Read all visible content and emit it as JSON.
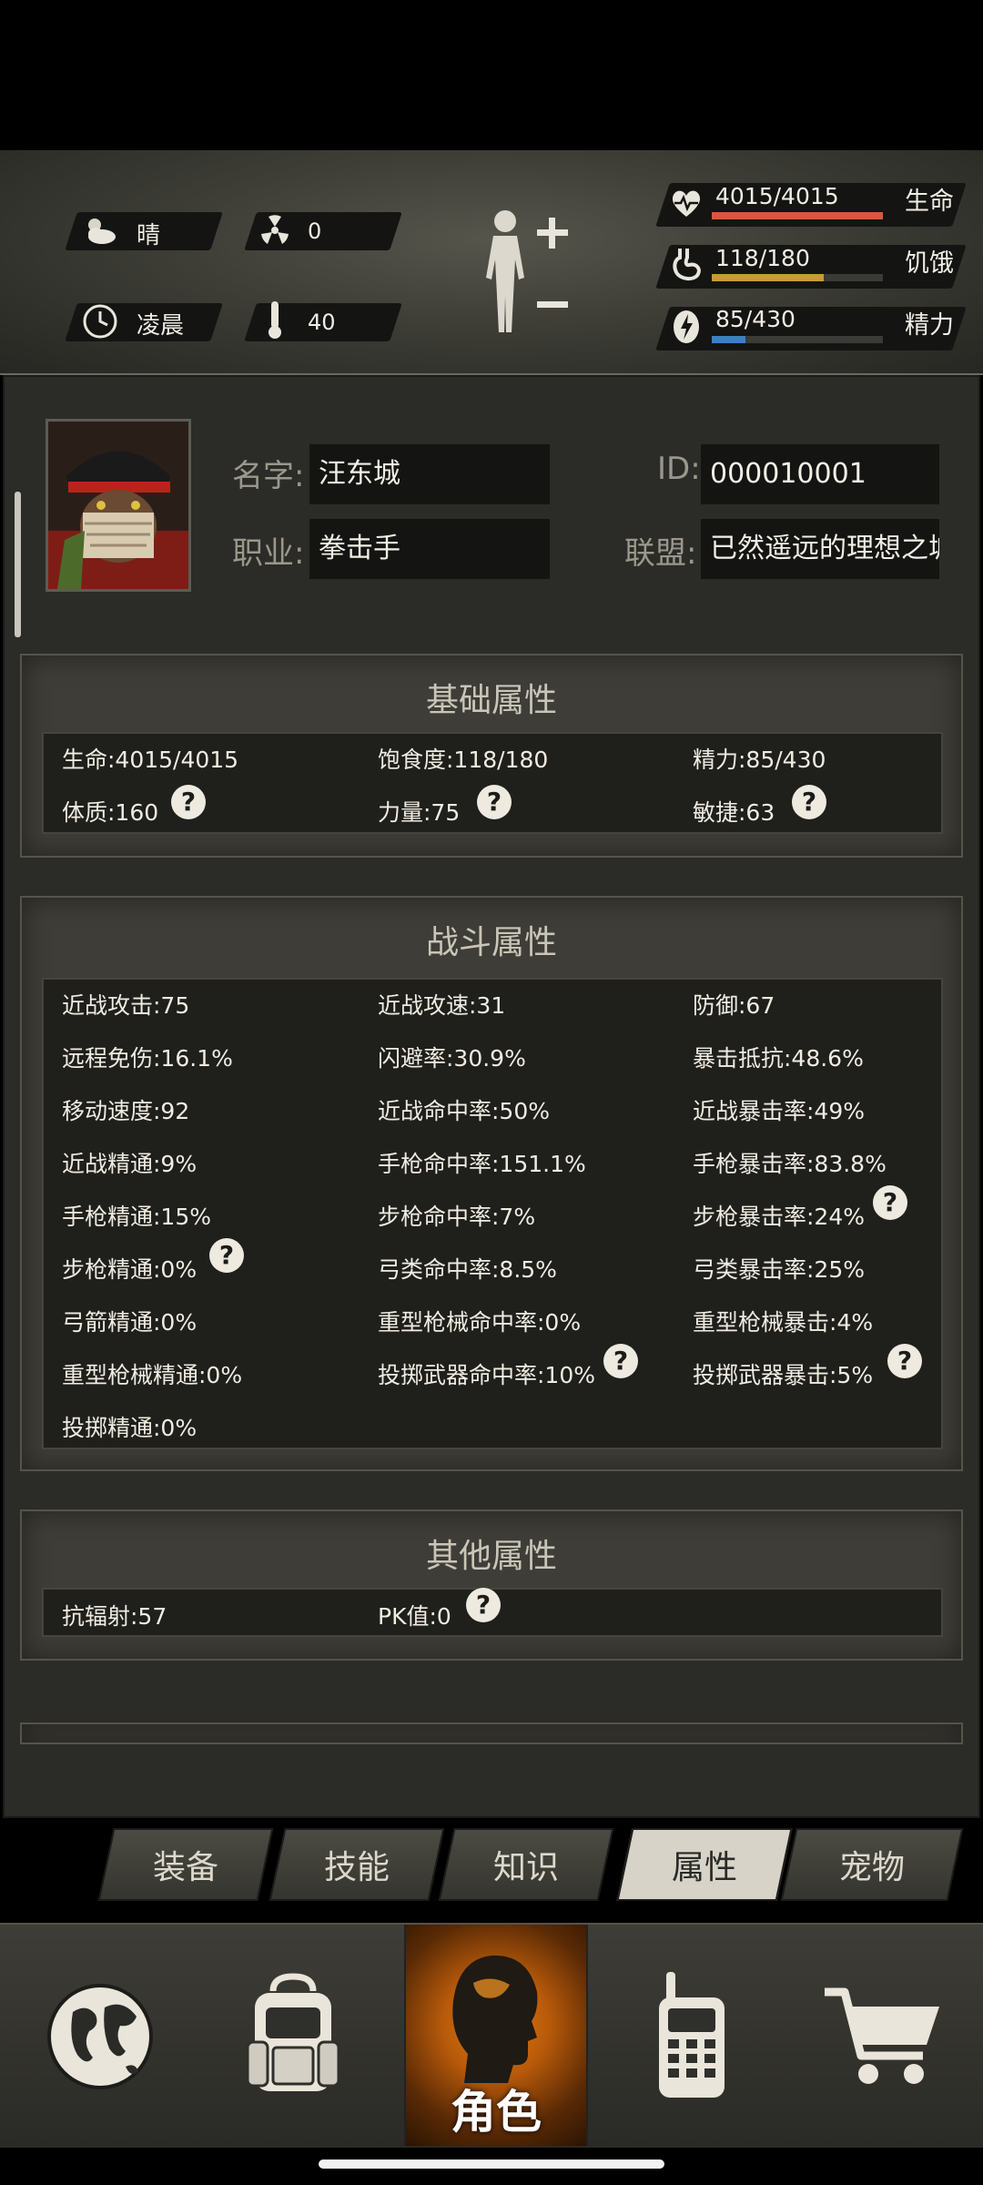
{
  "hud": {
    "weather": "晴",
    "radiation": "0",
    "time_of_day": "凌晨",
    "temperature": "40",
    "life": {
      "text": "4015/4015",
      "label": "生命",
      "fraction": 1.0,
      "color": "#d9583b"
    },
    "hunger": {
      "text": "118/180",
      "label": "饥饿",
      "fraction": 0.656,
      "color": "#c79a3a"
    },
    "energy": {
      "text": "85/430",
      "label": "精力",
      "fraction": 0.198,
      "color": "#3e7fc4"
    }
  },
  "profile": {
    "name_label": "名字:",
    "name_value": "汪东城",
    "id_label": "ID:",
    "id_value": "000010001",
    "job_label": "职业:",
    "job_value": "拳击手",
    "alliance_label": "联盟:",
    "alliance_value": "已然遥远的理想之城"
  },
  "basic": {
    "title": "基础属性",
    "stats": [
      "生命:4015/4015",
      "饱食度:118/180",
      "精力:85/430",
      "体质:160",
      "力量:75",
      "敏捷:63"
    ]
  },
  "combat": {
    "title": "战斗属性",
    "stats": [
      "近战攻击:75",
      "近战攻速:31",
      "防御:67",
      "远程免伤:16.1%",
      "闪避率:30.9%",
      "暴击抵抗:48.6%",
      "移动速度:92",
      "近战命中率:50%",
      "近战暴击率:49%",
      "近战精通:9%",
      "手枪命中率:151.1%",
      "手枪暴击率:83.8%",
      "手枪精通:15%",
      "步枪命中率:7%",
      "步枪暴击率:24%",
      "步枪精通:0%",
      "弓类命中率:8.5%",
      "弓类暴击率:25%",
      "弓箭精通:0%",
      "重型枪械命中率:0%",
      "重型枪械暴击:4%",
      "重型枪械精通:0%",
      "投掷武器命中率:10%",
      "投掷武器暴击:5%",
      "投掷精通:0%"
    ]
  },
  "other": {
    "title": "其他属性",
    "stats": [
      "抗辐射:57",
      "PK值:0"
    ]
  },
  "help_glyph": "?",
  "tabs": [
    "装备",
    "技能",
    "知识",
    "属性",
    "宠物"
  ],
  "active_tab": "属性",
  "nav": {
    "role_label": "角色",
    "icons": [
      "globe-icon",
      "backpack-icon",
      "role-head-icon",
      "walkie-talkie-icon",
      "cart-icon"
    ]
  }
}
